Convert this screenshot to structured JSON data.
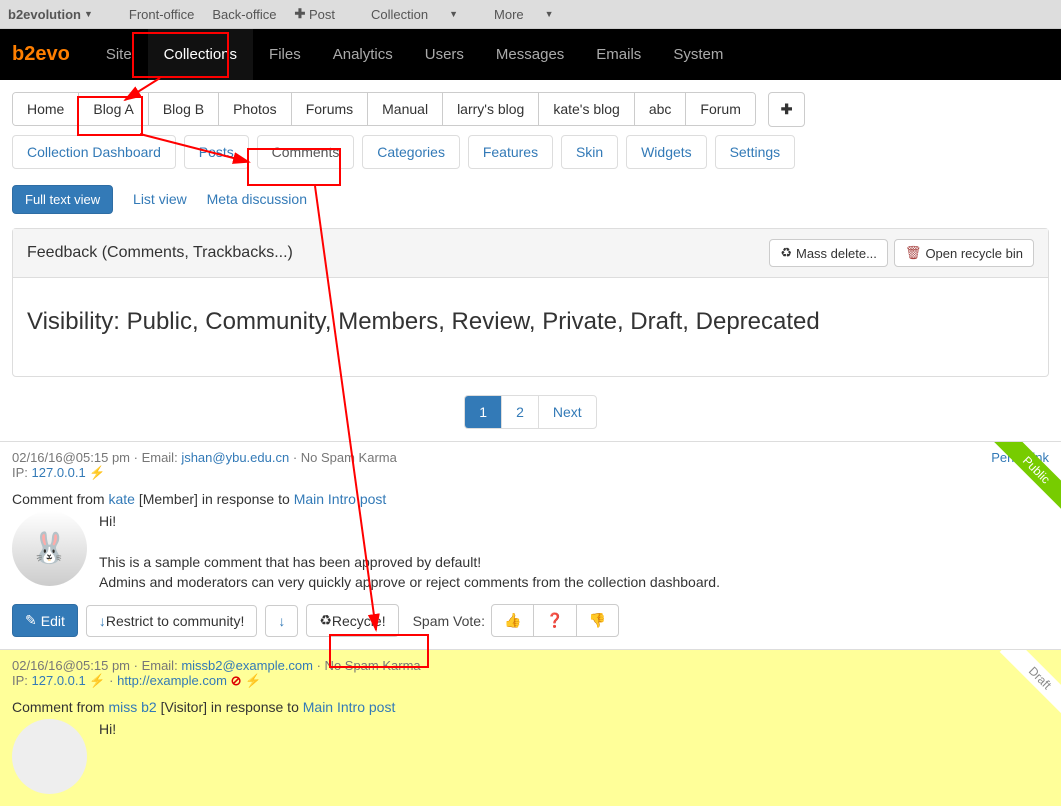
{
  "topbar": {
    "brand": "b2evolution",
    "items": [
      "Front-office",
      "Back-office",
      "Post",
      "Collection",
      "More"
    ]
  },
  "nav": {
    "brand": "b2evo",
    "items": [
      "Site",
      "Collections",
      "Files",
      "Analytics",
      "Users",
      "Messages",
      "Emails",
      "System"
    ],
    "active": "Collections"
  },
  "blog_tabs": [
    "Home",
    "Blog A",
    "Blog B",
    "Photos",
    "Forums",
    "Manual",
    "larry's blog",
    "kate's blog",
    "abc",
    "Forum"
  ],
  "blog_active": "Blog A",
  "subtabs": [
    "Collection Dashboard",
    "Posts",
    "Comments",
    "Categories",
    "Features",
    "Skin",
    "Widgets",
    "Settings"
  ],
  "subtab_active": "Comments",
  "viewbar": {
    "full": "Full text view",
    "list": "List view",
    "meta": "Meta discussion"
  },
  "panel": {
    "title": "Feedback (Comments, Trackbacks...)",
    "mass_delete": "Mass delete...",
    "recycle_bin": "Open recycle bin",
    "visibility": "Visibility: Public, Community, Members, Review, Private, Draft, Deprecated"
  },
  "pager": {
    "p1": "1",
    "p2": "2",
    "next": "Next"
  },
  "c1": {
    "ts": "02/16/16@05:15 pm",
    "mid": " · Email: ",
    "email": "jshan@ybu.edu.cn",
    "karma": " · No Spam Karma",
    "ip_lbl": "IP: ",
    "ip": "127.0.0.1",
    "perm": "Permalink",
    "ribbon": "Public",
    "from_pre": "Comment from ",
    "from_user": "kate",
    "from_role": " [Member] in response to ",
    "from_post": "Main Intro post",
    "l1": "Hi!",
    "l2": "This is a sample comment that has been approved by default!",
    "l3": "Admins and moderators can very quickly approve or reject comments from the collection dashboard.",
    "edit": "Edit",
    "restrict": "Restrict to community!",
    "recycle": "Recycle!",
    "spam": "Spam Vote:"
  },
  "c2": {
    "ts": "02/16/16@05:15 pm",
    "mid": " · Email: ",
    "email": "missb2@example.com",
    "karma": " · No Spam Karma",
    "ip_lbl": "IP: ",
    "ip": "127.0.0.1",
    "sep": " · ",
    "url": "http://example.com",
    "ribbon": "Draft",
    "from_pre": "Comment from ",
    "from_user": "miss b2",
    "from_role": " [Visitor] in response to ",
    "from_post": "Main Intro post",
    "l1": "Hi!"
  }
}
